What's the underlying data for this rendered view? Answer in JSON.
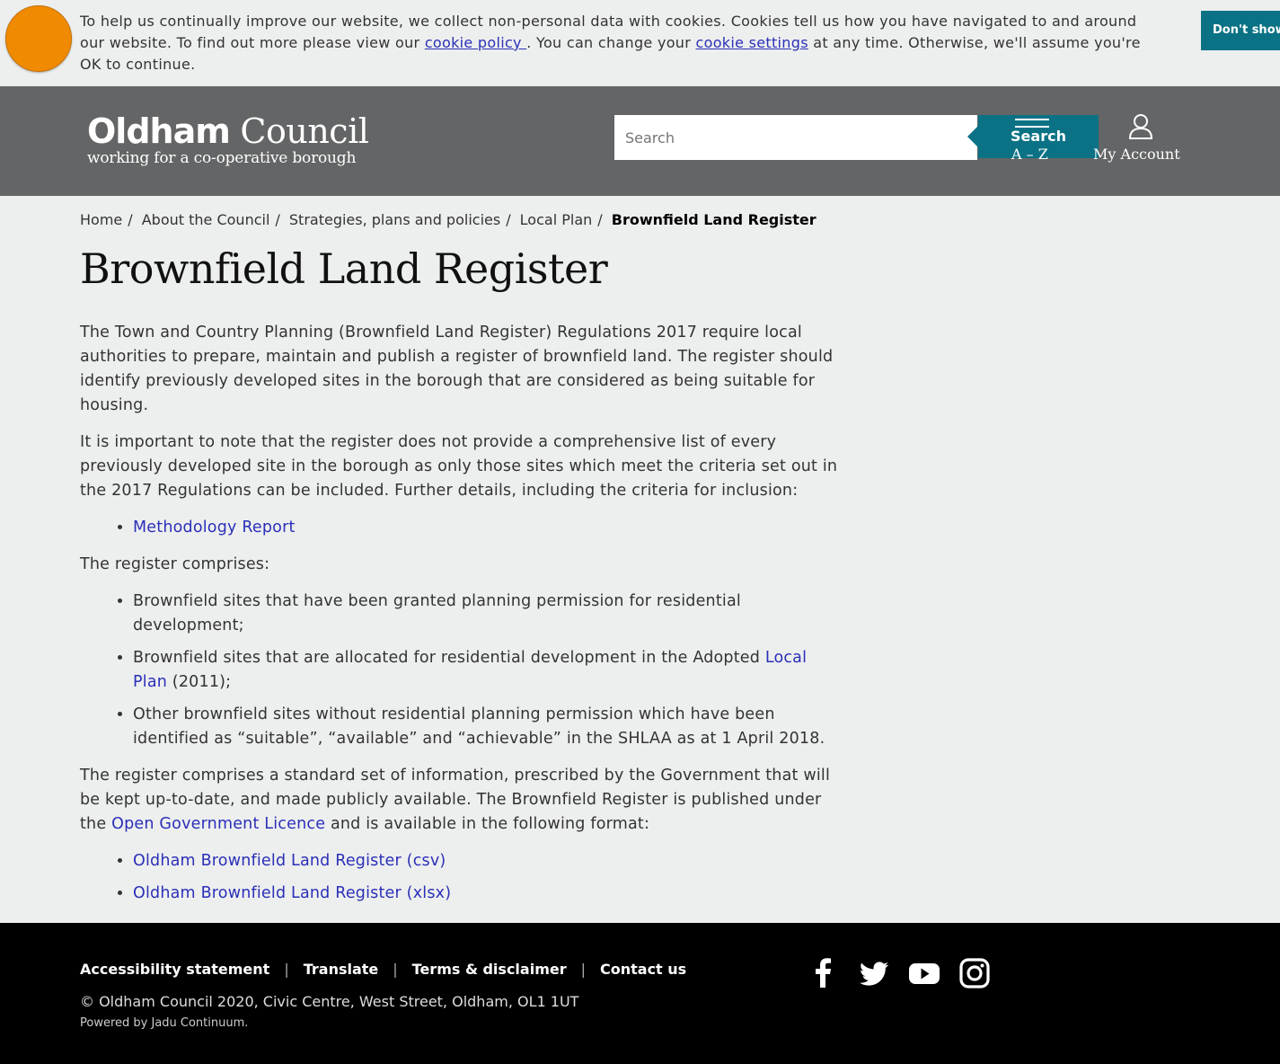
{
  "cookie": {
    "text1": "To help us continually improve our website, we collect non-personal data with cookies. Cookies tell us how you have navigated to and around our website. To find out more please view our ",
    "policy_link": "cookie policy ",
    "text2": ". You can change your ",
    "settings_link": "cookie settings",
    "text3": " at any time. Otherwise, we'll assume you're OK to continue.",
    "dont_show": "Don't show this message again"
  },
  "header": {
    "logo_bold": "Oldham",
    "logo_light": " Council",
    "logo_tagline": "working for a co-operative borough",
    "search_placeholder": "Search",
    "search_button": "Search",
    "az": "A – Z",
    "account": "My Account"
  },
  "breadcrumb": {
    "items": [
      "Home",
      "About the Council",
      "Strategies, plans and policies",
      "Local Plan"
    ],
    "current": "Brownfield Land Register"
  },
  "page": {
    "title": "Brownfield Land Register",
    "p1": "The Town and Country Planning (Brownfield Land Register) Regulations 2017 require local authorities to prepare, maintain and publish a register of brownfield land. The register should identify previously developed sites in the borough that are considered as being suitable for housing.",
    "p2": "It is important to note that the register does not provide a comprehensive list of every previously developed site in the borough as only those sites which meet the criteria set out in the 2017 Regulations can be included. Further details, including the criteria for inclusion:",
    "methodology_link": "Methodology Report",
    "p3": "The register comprises:",
    "li1": "Brownfield sites that have been granted planning permission for residential development;",
    "li2_pre": "Brownfield sites that are allocated for residential development in the Adopted ",
    "li2_link": "Local Plan",
    "li2_post": " (2011);",
    "li3": "Other brownfield sites without residential planning permission which have been identified as “suitable”, “available” and “achievable” in the SHLAA as at 1 April 2018.",
    "p4_pre": "The register comprises a standard set of information, prescribed by the Government that will be kept up-to-date, and made publicly available. The Brownfield Register is published under the ",
    "p4_link": "Open Government Licence",
    "p4_post": " and is available in the following format:",
    "csv_link": "Oldham Brownfield Land Register (csv)",
    "xlsx_link": "Oldham Brownfield Land Register (xlsx)"
  },
  "footer": {
    "links": [
      "Accessibility statement",
      "Translate",
      "Terms & disclaimer",
      "Contact us"
    ],
    "copyright": "© Oldham Council 2020, Civic Centre, West Street, Oldham, OL1 1UT",
    "powered": "Powered by Jadu Continuum."
  },
  "colors": {
    "accent": "#0b7285",
    "header_bg": "#646566",
    "cookie_badge": "#f08a00",
    "link": "#2b2fb8"
  }
}
